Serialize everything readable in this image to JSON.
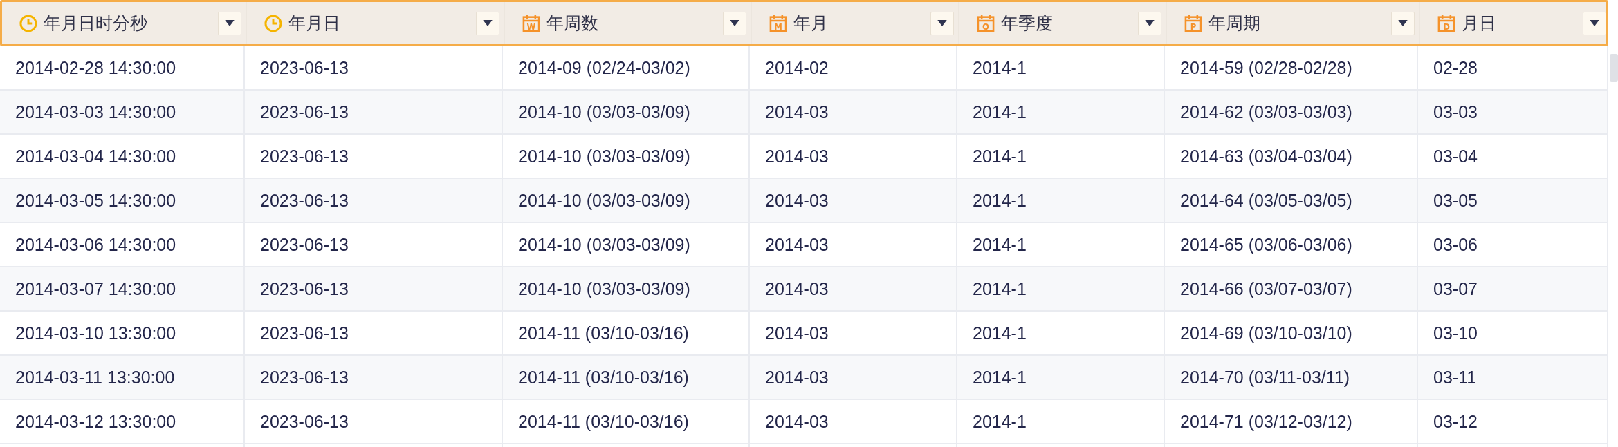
{
  "table": {
    "columns": [
      {
        "title": "年月日时分秒",
        "kind": "datetime"
      },
      {
        "title": "年月日",
        "kind": "datetime"
      },
      {
        "title": "年周数",
        "kind": "period",
        "icon_letter": "W"
      },
      {
        "title": "年月",
        "kind": "period",
        "icon_letter": "M"
      },
      {
        "title": "年季度",
        "kind": "period",
        "icon_letter": "Q"
      },
      {
        "title": "年周期",
        "kind": "period",
        "icon_letter": "P"
      },
      {
        "title": "月日",
        "kind": "period",
        "icon_letter": "D"
      }
    ],
    "rows": [
      [
        "2014-02-28 14:30:00",
        "2023-06-13",
        "2014-09 (02/24-03/02)",
        "2014-02",
        "2014-1",
        "2014-59 (02/28-02/28)",
        "02-28"
      ],
      [
        "2014-03-03 14:30:00",
        "2023-06-13",
        "2014-10 (03/03-03/09)",
        "2014-03",
        "2014-1",
        "2014-62 (03/03-03/03)",
        "03-03"
      ],
      [
        "2014-03-04 14:30:00",
        "2023-06-13",
        "2014-10 (03/03-03/09)",
        "2014-03",
        "2014-1",
        "2014-63 (03/04-03/04)",
        "03-04"
      ],
      [
        "2014-03-05 14:30:00",
        "2023-06-13",
        "2014-10 (03/03-03/09)",
        "2014-03",
        "2014-1",
        "2014-64 (03/05-03/05)",
        "03-05"
      ],
      [
        "2014-03-06 14:30:00",
        "2023-06-13",
        "2014-10 (03/03-03/09)",
        "2014-03",
        "2014-1",
        "2014-65 (03/06-03/06)",
        "03-06"
      ],
      [
        "2014-03-07 14:30:00",
        "2023-06-13",
        "2014-10 (03/03-03/09)",
        "2014-03",
        "2014-1",
        "2014-66 (03/07-03/07)",
        "03-07"
      ],
      [
        "2014-03-10 13:30:00",
        "2023-06-13",
        "2014-11 (03/10-03/16)",
        "2014-03",
        "2014-1",
        "2014-69 (03/10-03/10)",
        "03-10"
      ],
      [
        "2014-03-11 13:30:00",
        "2023-06-13",
        "2014-11 (03/10-03/16)",
        "2014-03",
        "2014-1",
        "2014-70 (03/11-03/11)",
        "03-11"
      ],
      [
        "2014-03-12 13:30:00",
        "2023-06-13",
        "2014-11 (03/10-03/16)",
        "2014-03",
        "2014-1",
        "2014-71 (03/12-03/12)",
        "03-12"
      ]
    ]
  }
}
